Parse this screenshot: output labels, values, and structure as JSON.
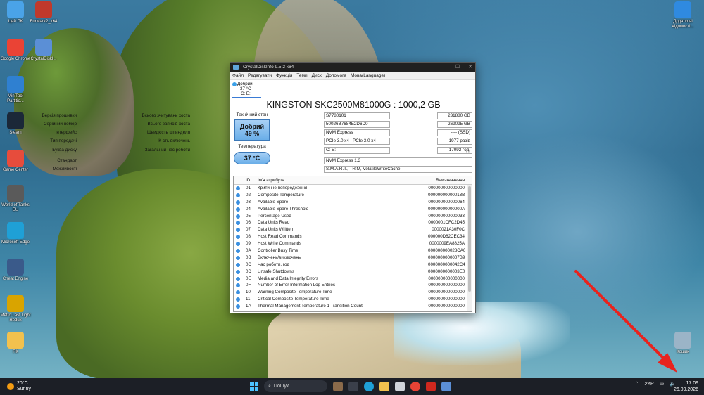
{
  "desktop": {
    "icons": [
      {
        "label": "Цей ПК",
        "icon": "computer-icon",
        "color": "#4aa3e8"
      },
      {
        "label": "FurMark2_x64",
        "icon": "furmark-icon",
        "color": "#c0392b"
      },
      {
        "label": "Google Chrome",
        "icon": "chrome-icon",
        "color": "#ea4335"
      },
      {
        "label": "CrystalDiskI...",
        "icon": "crystaldisk-icon",
        "color": "#5b8fd6"
      },
      {
        "label": "MiniTool Partitio...",
        "icon": "minitool-icon",
        "color": "#2f80d1"
      },
      {
        "label": "Steam",
        "icon": "steam-icon",
        "color": "#1b2838"
      },
      {
        "label": "Game Center",
        "icon": "gamecenter-icon",
        "color": "#e74c3c"
      },
      {
        "label": "World of Tanks EU",
        "icon": "wot-icon",
        "color": "#5a5a5a"
      },
      {
        "label": "Microsoft Edge",
        "icon": "edge-icon",
        "color": "#1fa0d6"
      },
      {
        "label": "Cheat Engine",
        "icon": "cheatengine-icon",
        "color": "#3a5a8a"
      },
      {
        "label": "Metro Last Light Redux",
        "icon": "metro-icon",
        "color": "#d9a400"
      },
      {
        "label": "ПК",
        "icon": "folder-icon",
        "color": "#f2c14e"
      },
      {
        "label": "Додаткові відомості...",
        "icon": "info-icon",
        "color": "#2f8ae0"
      },
      {
        "label": "Кошик",
        "icon": "recycle-bin-icon",
        "color": "#9bb4c7"
      }
    ]
  },
  "window": {
    "title": "CrystalDiskInfo 9.5.2 x64",
    "controls": [
      "—",
      "☐",
      "✕"
    ],
    "menu": [
      "Файл",
      "Редагувати",
      "Функція",
      "Теми",
      "Диск",
      "Допомога",
      "Мова(Language)"
    ],
    "drive_tab": {
      "status": "Добрий",
      "temp": "37 °C",
      "letters": "C: E:"
    },
    "drive_title": "KINGSTON SKC2500M81000G : 1000,2 GB",
    "health_label": "Технічний стан",
    "health_status": "Добрий",
    "health_percent": "49 %",
    "temp_label": "Температура",
    "temp_value": "37 °C",
    "info": {
      "firmware_label": "Версія прошивки",
      "firmware": "S7780101",
      "serial_label": "Серійний номер",
      "serial": "50026B7684E2D6D0",
      "interface_label": "Інтерфейс",
      "interface": "NVM Express",
      "transfer_label": "Тип передачі",
      "transfer": "PCIe 3.0 x4 | PCIe 3.0 x4",
      "letters_label": "Буква диску",
      "letters": "C: E:",
      "standard_label": "Стандарт",
      "standard": "NVM Express 1.3",
      "features_label": "Можливості",
      "features": "S.M.A.R.T., TRIM, VolatileWriteCache",
      "host_reads_label": "Всього зчитувань хоста",
      "host_reads": "231880 GB",
      "host_writes_label": "Всього записів хоста",
      "host_writes": "269095 GB",
      "rotation_label": "Швидкість шпинделя",
      "rotation": "---- (SSD)",
      "power_count_label": "К-сть включень",
      "power_count": "1977 разів",
      "power_hours_label": "Загальний час роботи",
      "power_hours": "17092 год."
    },
    "table": {
      "headers": [
        "",
        "ID",
        "Ім'я атрибута",
        "Raw-значення"
      ],
      "rows": [
        {
          "id": "01",
          "name": "Критичне попередження",
          "raw": "000000000000000"
        },
        {
          "id": "02",
          "name": "Composite Temperature",
          "raw": "00000000000013B"
        },
        {
          "id": "03",
          "name": "Available Spare",
          "raw": "000000000000064"
        },
        {
          "id": "04",
          "name": "Available Spare Threshold",
          "raw": "00000000000000A"
        },
        {
          "id": "05",
          "name": "Percentage Used",
          "raw": "000000000000033"
        },
        {
          "id": "06",
          "name": "Data Units Read",
          "raw": "0000001CFC2D45"
        },
        {
          "id": "07",
          "name": "Data Units Written",
          "raw": "0000021A30F0C"
        },
        {
          "id": "08",
          "name": "Host Read Commands",
          "raw": "000000D62CEC34"
        },
        {
          "id": "09",
          "name": "Host Write Commands",
          "raw": "0000009EA8825A"
        },
        {
          "id": "0A",
          "name": "Controller Busy Time",
          "raw": "000000000028CA6"
        },
        {
          "id": "0B",
          "name": "Включень/виключень",
          "raw": "0000000000007B9"
        },
        {
          "id": "0C",
          "name": "Час роботи, год",
          "raw": "0000000000042C4"
        },
        {
          "id": "0D",
          "name": "Unsafe Shutdowns",
          "raw": "0000000000003E0"
        },
        {
          "id": "0E",
          "name": "Media and Data Integrity Errors",
          "raw": "000000000000000"
        },
        {
          "id": "0F",
          "name": "Number of Error Information Log Entries",
          "raw": "000000000000000"
        },
        {
          "id": "10",
          "name": "Warning Composite Temperature Time",
          "raw": "000000000000000"
        },
        {
          "id": "11",
          "name": "Critical Composite Temperature Time",
          "raw": "000000000000000"
        },
        {
          "id": "1A",
          "name": "Thermal Management Temperature 1 Transition Count",
          "raw": "000000000000000"
        }
      ]
    }
  },
  "taskbar": {
    "weather_temp": "20°C",
    "weather_text": "Sunny",
    "search_placeholder": "Пошук",
    "language": "УКР",
    "time": "17:09",
    "date": "26.09.2026"
  }
}
